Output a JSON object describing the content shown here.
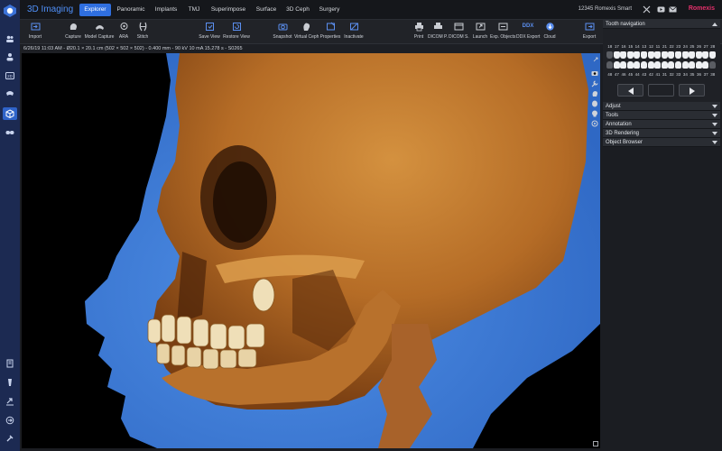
{
  "header": {
    "app_title": "3D Imaging",
    "tabs": [
      {
        "label": "Explorer",
        "active": true
      },
      {
        "label": "Panoramic"
      },
      {
        "label": "Implants"
      },
      {
        "label": "TMJ"
      },
      {
        "label": "Superimpose"
      },
      {
        "label": "Surface"
      },
      {
        "label": "3D Ceph"
      },
      {
        "label": "Surgery"
      }
    ],
    "user_info": "12345 Romexis Smart",
    "brand": "Romexis",
    "brand_color": "#e4306b",
    "icons": [
      "close-icon",
      "youtube-icon",
      "mail-icon"
    ]
  },
  "sidebar": {
    "items": [
      "patients-icon",
      "person-icon",
      "2d-icon",
      "dental-arch-icon",
      "3d-cube-icon",
      "scan-icon"
    ],
    "bottom_items": [
      "sensor-icon",
      "implant-icon",
      "export-icon",
      "logout-icon",
      "tools-icon"
    ],
    "active_index": 4,
    "labels": {
      "2d": "2D"
    }
  },
  "toolbar": {
    "import": "Import",
    "capture": "Capture",
    "model_capture": "Model Capture",
    "ara": "ARA",
    "stitch": "Stitch",
    "save_view": "Save View",
    "restore_view": "Restore View",
    "snapshot": "Snapshot",
    "virtual_ceph": "Virtual Ceph",
    "properties": "Properties",
    "inactivate": "Inactivate",
    "print": "Print",
    "dicom_p": "DICOM P.",
    "dicom_s": "DICOM S.",
    "launch": "Launch",
    "exp_objects": "Exp. Objects",
    "ddx_export": "DDX Export",
    "ddx_badge": "DDX",
    "cloud": "Cloud",
    "export": "Export"
  },
  "info_bar": "6/26/19 11:03 AM - Ø20.1 × 20.1 cm (502 × 502 × 502) - 0.400 mm - 90 kV 10 mA 15.278 s - S0265",
  "right_panel": {
    "tooth_navigation": "Tooth navigation",
    "upper_numbers": [
      "18",
      "17",
      "16",
      "15",
      "14",
      "13",
      "12",
      "11",
      "21",
      "22",
      "23",
      "24",
      "25",
      "26",
      "27",
      "28"
    ],
    "lower_numbers": [
      "48",
      "47",
      "46",
      "45",
      "44",
      "43",
      "42",
      "41",
      "31",
      "32",
      "33",
      "34",
      "35",
      "36",
      "37",
      "38"
    ],
    "nav_value": "",
    "sections": [
      "Adjust",
      "Tools",
      "Annotation",
      "3D Rendering",
      "Object Browser"
    ]
  },
  "colors": {
    "accent": "#2f6fe0",
    "soft_tissue": "#3d7dd8",
    "bone": "#c2782d",
    "sidebar": "#1c2a52"
  }
}
